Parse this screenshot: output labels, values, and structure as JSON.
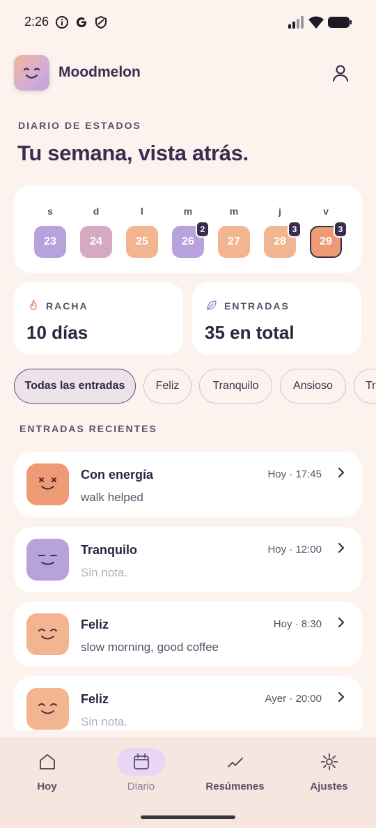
{
  "status_bar": {
    "time": "2:26",
    "icons": [
      "info-icon",
      "google-icon",
      "shield-icon",
      "signal-icon",
      "wifi-icon",
      "battery-icon"
    ]
  },
  "header": {
    "app_name": "Moodmelon",
    "logo_icon": "smile-face-icon",
    "profile_icon": "person-icon"
  },
  "section": {
    "eyebrow": "DIARIO DE ESTADOS",
    "title": "Tu semana, vista atrás."
  },
  "week": {
    "days": [
      {
        "letter": "s",
        "date": "23",
        "color": "#b7a2dc",
        "badge": ""
      },
      {
        "letter": "d",
        "date": "24",
        "color": "#d5a9c2",
        "badge": ""
      },
      {
        "letter": "l",
        "date": "25",
        "color": "#f3b58f",
        "badge": ""
      },
      {
        "letter": "m",
        "date": "26",
        "color": "#b7a2dc",
        "badge": "2"
      },
      {
        "letter": "m",
        "date": "27",
        "color": "#f3b58f",
        "badge": ""
      },
      {
        "letter": "j",
        "date": "28",
        "color": "#f3b58f",
        "badge": "3"
      },
      {
        "letter": "v",
        "date": "29",
        "color": "#ee9a74",
        "badge": "3",
        "selected": true
      }
    ]
  },
  "stats": {
    "streak_label": "RACHA",
    "streak_value": "10 días",
    "streak_icon": "flame-icon",
    "entries_label": "ENTRADAS",
    "entries_value": "35 en total",
    "entries_icon": "leaf-icon"
  },
  "filters": {
    "chips": [
      {
        "label": "Todas las entradas",
        "active": true
      },
      {
        "label": "Feliz"
      },
      {
        "label": "Tranquilo"
      },
      {
        "label": "Ansioso"
      },
      {
        "label": "Tr"
      }
    ]
  },
  "recent": {
    "eyebrow": "ENTRADAS RECIENTES",
    "entries": [
      {
        "title": "Con energía",
        "time": "Hoy · 17:45",
        "note": "walk helped",
        "empty": false,
        "face": "energetic-face-icon",
        "color": "#ee9a74"
      },
      {
        "title": "Tranquilo",
        "time": "Hoy · 12:00",
        "note": "Sin nota.",
        "empty": true,
        "face": "calm-face-icon",
        "color": "#b7a2dc"
      },
      {
        "title": "Feliz",
        "time": "Hoy · 8:30",
        "note": "slow morning, good coffee",
        "empty": false,
        "face": "happy-face-icon",
        "color": "#f3b58f"
      },
      {
        "title": "Feliz",
        "time": "Ayer · 20:00",
        "note": "Sin nota.",
        "empty": true,
        "face": "happy-face-icon",
        "color": "#f3b58f"
      }
    ]
  },
  "nav": {
    "items": [
      {
        "label": "Hoy",
        "icon": "home-icon"
      },
      {
        "label": "Diario",
        "icon": "calendar-icon",
        "active": true
      },
      {
        "label": "Resúmenes",
        "icon": "trend-icon"
      },
      {
        "label": "Ajustes",
        "icon": "sun-icon"
      }
    ]
  }
}
